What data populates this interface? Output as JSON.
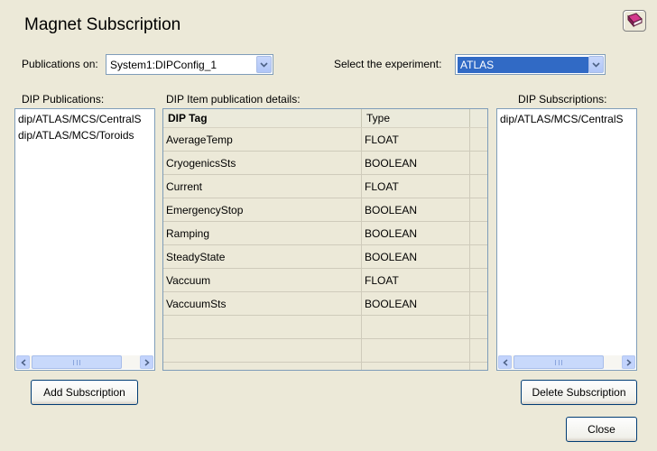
{
  "window": {
    "title": "Magnet Subscription"
  },
  "icons": {
    "help": "help-book-icon",
    "combo_arrow": "chevron-down-icon",
    "scroll_left": "arrow-left-icon",
    "scroll_right": "arrow-right-icon"
  },
  "publications_on": {
    "label": "Publications on:",
    "value": "System1:DIPConfig_1"
  },
  "experiment": {
    "label": "Select the experiment:",
    "value": "ATLAS"
  },
  "dip_publications": {
    "label": "DIP Publications:",
    "items": [
      "dip/ATLAS/MCS/CentralS",
      "dip/ATLAS/MCS/Toroids"
    ]
  },
  "details": {
    "label": "DIP Item publication details:",
    "columns": [
      "DIP Tag",
      "Type"
    ],
    "rows": [
      [
        "AverageTemp",
        "FLOAT"
      ],
      [
        "CryogenicsSts",
        "BOOLEAN"
      ],
      [
        "Current",
        "FLOAT"
      ],
      [
        "EmergencyStop",
        "BOOLEAN"
      ],
      [
        "Ramping",
        "BOOLEAN"
      ],
      [
        "SteadyState",
        "BOOLEAN"
      ],
      [
        "Vaccuum",
        "FLOAT"
      ],
      [
        "VaccuumSts",
        "BOOLEAN"
      ],
      [
        "",
        ""
      ],
      [
        "",
        ""
      ],
      [
        "",
        ""
      ]
    ]
  },
  "dip_subscriptions": {
    "label": "DIP Subscriptions:",
    "items": [
      "dip/ATLAS/MCS/CentralS"
    ]
  },
  "buttons": {
    "add": "Add Subscription",
    "delete": "Delete Subscription",
    "close": "Close"
  },
  "colors": {
    "selection": "#316ac5",
    "dialog_bg": "#ece9d8",
    "border": "#7f9db9"
  }
}
